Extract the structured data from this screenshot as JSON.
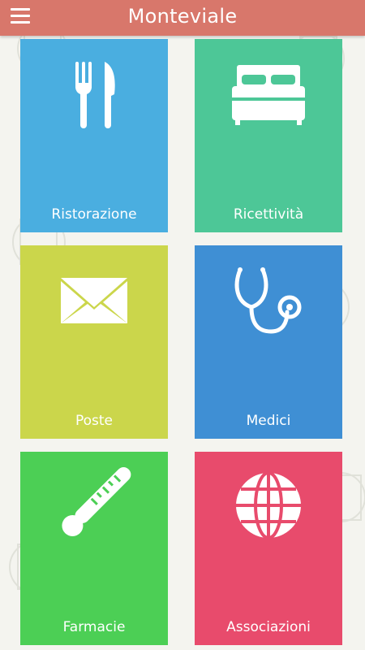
{
  "header": {
    "title": "Monteviale",
    "menu_icon": "hamburger-menu-icon",
    "background": "#d8776b"
  },
  "tiles": [
    {
      "label": "Ristorazione",
      "icon": "fork-knife-icon",
      "color": "#4aaee0"
    },
    {
      "label": "Ricettività",
      "icon": "bed-icon",
      "color": "#4dc797"
    },
    {
      "label": "Poste",
      "icon": "envelope-icon",
      "color": "#cbd64b"
    },
    {
      "label": "Medici",
      "icon": "stethoscope-icon",
      "color": "#3f8fd4"
    },
    {
      "label": "Farmacie",
      "icon": "thermometer-icon",
      "color": "#4ccf55"
    },
    {
      "label": "Associazioni",
      "icon": "globe-icon",
      "color": "#e84b6c"
    }
  ]
}
